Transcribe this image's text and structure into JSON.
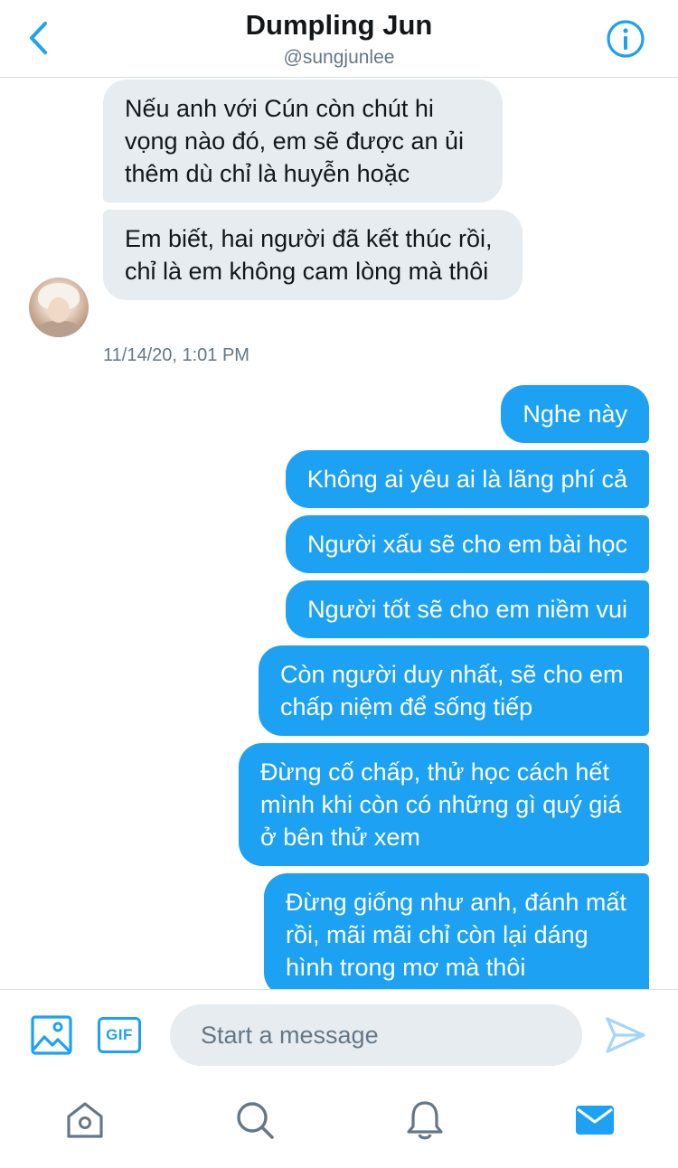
{
  "header": {
    "title": "Dumpling Jun",
    "handle": "@sungjunlee",
    "back_icon": "chevron-left-icon",
    "info_icon": "info-circle-icon",
    "accent_color": "#1da1f2"
  },
  "conversation": {
    "incoming": [
      {
        "text": "Nếu anh với Cún còn chút hi vọng nào đó, em sẽ được an ủi thêm dù chỉ là huyễn hoặc"
      },
      {
        "text": "Em biết, hai người đã kết thúc rồi, chỉ là em không cam lòng mà thôi"
      }
    ],
    "timestamp": "11/14/20, 1:01 PM",
    "outgoing": [
      {
        "text": "Nghe này"
      },
      {
        "text": "Không ai yêu ai là lãng phí cả"
      },
      {
        "text": "Người xấu sẽ cho em bài học"
      },
      {
        "text": "Người tốt sẽ cho em niềm vui"
      },
      {
        "text": "Còn người duy nhất, sẽ cho em chấp niệm để sống tiếp"
      },
      {
        "text": "Đừng cố chấp, thử học cách hết mình khi còn có những gì quý giá ở bên thử xem"
      },
      {
        "text": "Đừng giống như anh, đánh mất rồi, mãi mãi chỉ còn lại dáng hình trong mơ mà thôi"
      }
    ],
    "incoming_bubble_color": "#e6ecf0",
    "outgoing_bubble_color": "#1da1f2"
  },
  "composer": {
    "placeholder": "Start a message",
    "value": "",
    "gif_label": "GIF",
    "media_icon": "image-icon",
    "send_icon": "send-icon"
  },
  "tabbar": {
    "items": [
      {
        "icon": "home-icon"
      },
      {
        "icon": "search-icon"
      },
      {
        "icon": "bell-icon"
      },
      {
        "icon": "mail-icon",
        "active": true
      }
    ]
  }
}
